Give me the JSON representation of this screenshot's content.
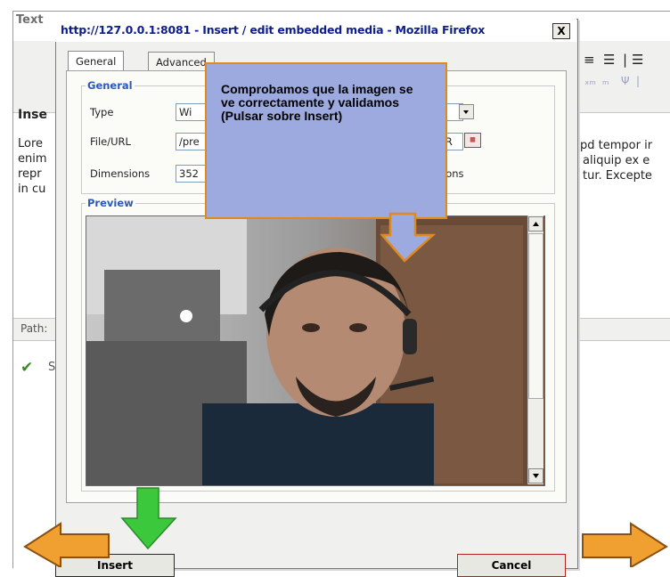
{
  "background_editor": {
    "title": "Text",
    "heading": "Inse",
    "left_lines": [
      "Lore",
      "enim",
      "repr",
      "in cu"
    ],
    "right_lines": [
      "pd tempor ir",
      "aliquip ex e",
      "tur. Excepte"
    ],
    "path_label": "Path:",
    "status_partial": "S"
  },
  "dialog": {
    "window_title": "http://127.0.0.1:8081 - Insert / edit embedded media - Mozilla Firefox",
    "close_label": "X",
    "tabs": [
      {
        "label": "General",
        "active": true
      },
      {
        "label": "Advanced",
        "active": false
      }
    ],
    "general_legend": "General",
    "type_label": "Type",
    "type_value": "Wi",
    "file_label": "File/URL",
    "file_value": "/pre",
    "file_value_tail": "_R",
    "dimensions_label": "Dimensions",
    "dimensions_value": "352",
    "constrain_label_tail": "ions",
    "preview_legend": "Preview",
    "insert_label": "Insert",
    "cancel_label": "Cancel"
  },
  "callout": {
    "text": "Comprobamos que la imagen se ve correctamente y validamos (Pulsar sobre Insert)"
  },
  "colors": {
    "callout_fill": "#9caadf",
    "callout_border": "#e08a1e",
    "orange_arrow": "#f0a030",
    "green_arrow": "#3cc83c",
    "legend_blue": "#2f58b8",
    "title_blue": "#0e1e8a"
  },
  "icons": [
    "close-icon",
    "browse-icon",
    "dropdown-arrow-icon",
    "scroll-up-icon",
    "scroll-down-icon",
    "check-icon",
    "arrow-left-icon",
    "arrow-right-icon",
    "arrow-down-icon"
  ]
}
